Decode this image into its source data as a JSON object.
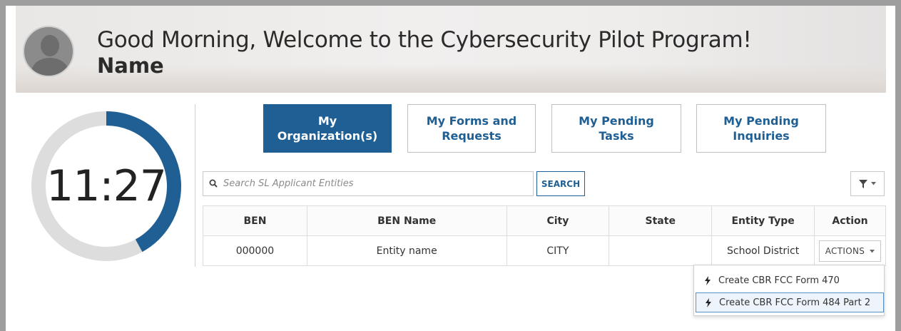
{
  "header": {
    "greeting": "Good Morning, Welcome to the Cybersecurity Pilot Program!",
    "username": "Name"
  },
  "timer": {
    "display": "11:27",
    "progress_fraction": 0.42,
    "track_color": "#dddddd",
    "progress_color": "#1f5f94"
  },
  "tabs": [
    {
      "label": "My Organization(s)",
      "active": true
    },
    {
      "label": "My Forms and Requests",
      "active": false
    },
    {
      "label": "My Pending Tasks",
      "active": false
    },
    {
      "label": "My Pending Inquiries",
      "active": false
    }
  ],
  "search": {
    "placeholder": "Search SL Applicant Entities",
    "button_label": "SEARCH"
  },
  "filter": {
    "icon": "filter-icon",
    "caret": "caret-down-icon"
  },
  "table": {
    "headers": [
      "BEN",
      "BEN Name",
      "City",
      "State",
      "Entity Type",
      "Action"
    ],
    "rows": [
      {
        "ben": "000000",
        "ben_name": "Entity name",
        "city": "CITY",
        "state": "",
        "entity_type": "School District",
        "action_label": "ACTIONS"
      }
    ]
  },
  "actions_menu": {
    "items": [
      {
        "label": "Create CBR FCC Form 470",
        "icon": "bolt-icon",
        "highlighted": false
      },
      {
        "label": "Create CBR FCC Form 484 Part 2",
        "icon": "bolt-icon",
        "highlighted": true
      }
    ]
  },
  "colors": {
    "accent": "#1f5f94",
    "link": "#1f6fb0",
    "frame": "#9e9e9e"
  }
}
